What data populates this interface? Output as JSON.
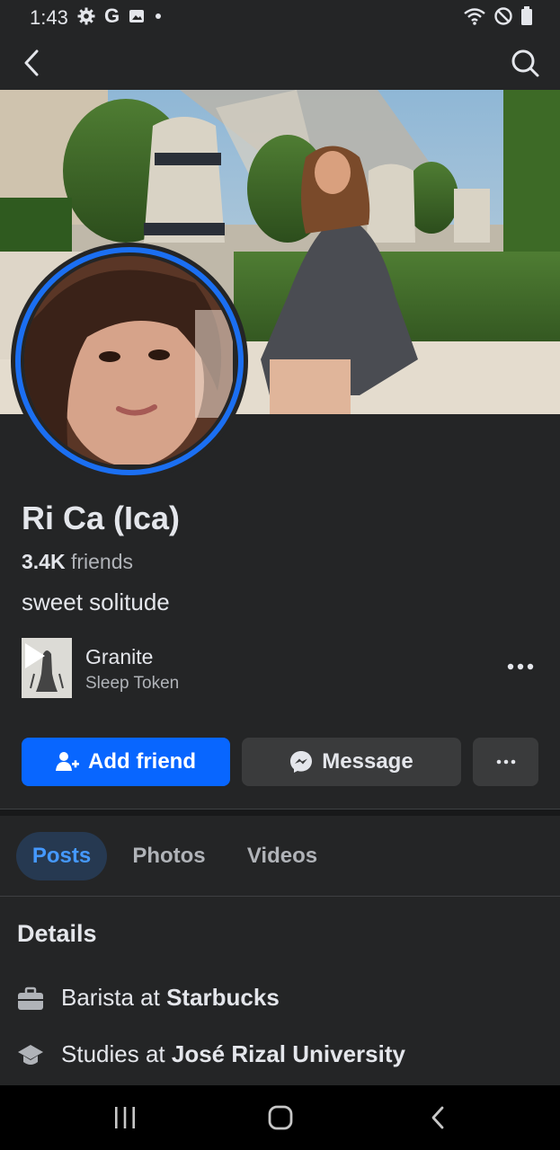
{
  "status_bar": {
    "time": "1:43",
    "icons_left": [
      "gear-icon",
      "google-icon",
      "photo-icon",
      "dot-icon"
    ],
    "icons_right": [
      "wifi-icon",
      "do-not-disturb-icon",
      "battery-icon"
    ]
  },
  "top_nav": {
    "back_icon": "chevron-left-icon",
    "search_icon": "search-icon"
  },
  "profile": {
    "name": "Ri Ca (Ica)",
    "friends_count": "3.4K",
    "friends_label": "friends",
    "bio": "sweet solitude"
  },
  "song": {
    "title": "Granite",
    "artist": "Sleep Token"
  },
  "actions": {
    "add_friend": "Add friend",
    "message": "Message"
  },
  "tabs": [
    {
      "label": "Posts",
      "active": true
    },
    {
      "label": "Photos",
      "active": false
    },
    {
      "label": "Videos",
      "active": false
    }
  ],
  "details": {
    "title": "Details",
    "work_prefix": "Barista at ",
    "work_place": "Starbucks",
    "edu_prefix": "Studies at ",
    "edu_place": "José Rizal University"
  },
  "colors": {
    "accent": "#0866ff",
    "background": "#242526",
    "ring": "#1b6ff2",
    "active_tab_text": "#4599ff"
  }
}
